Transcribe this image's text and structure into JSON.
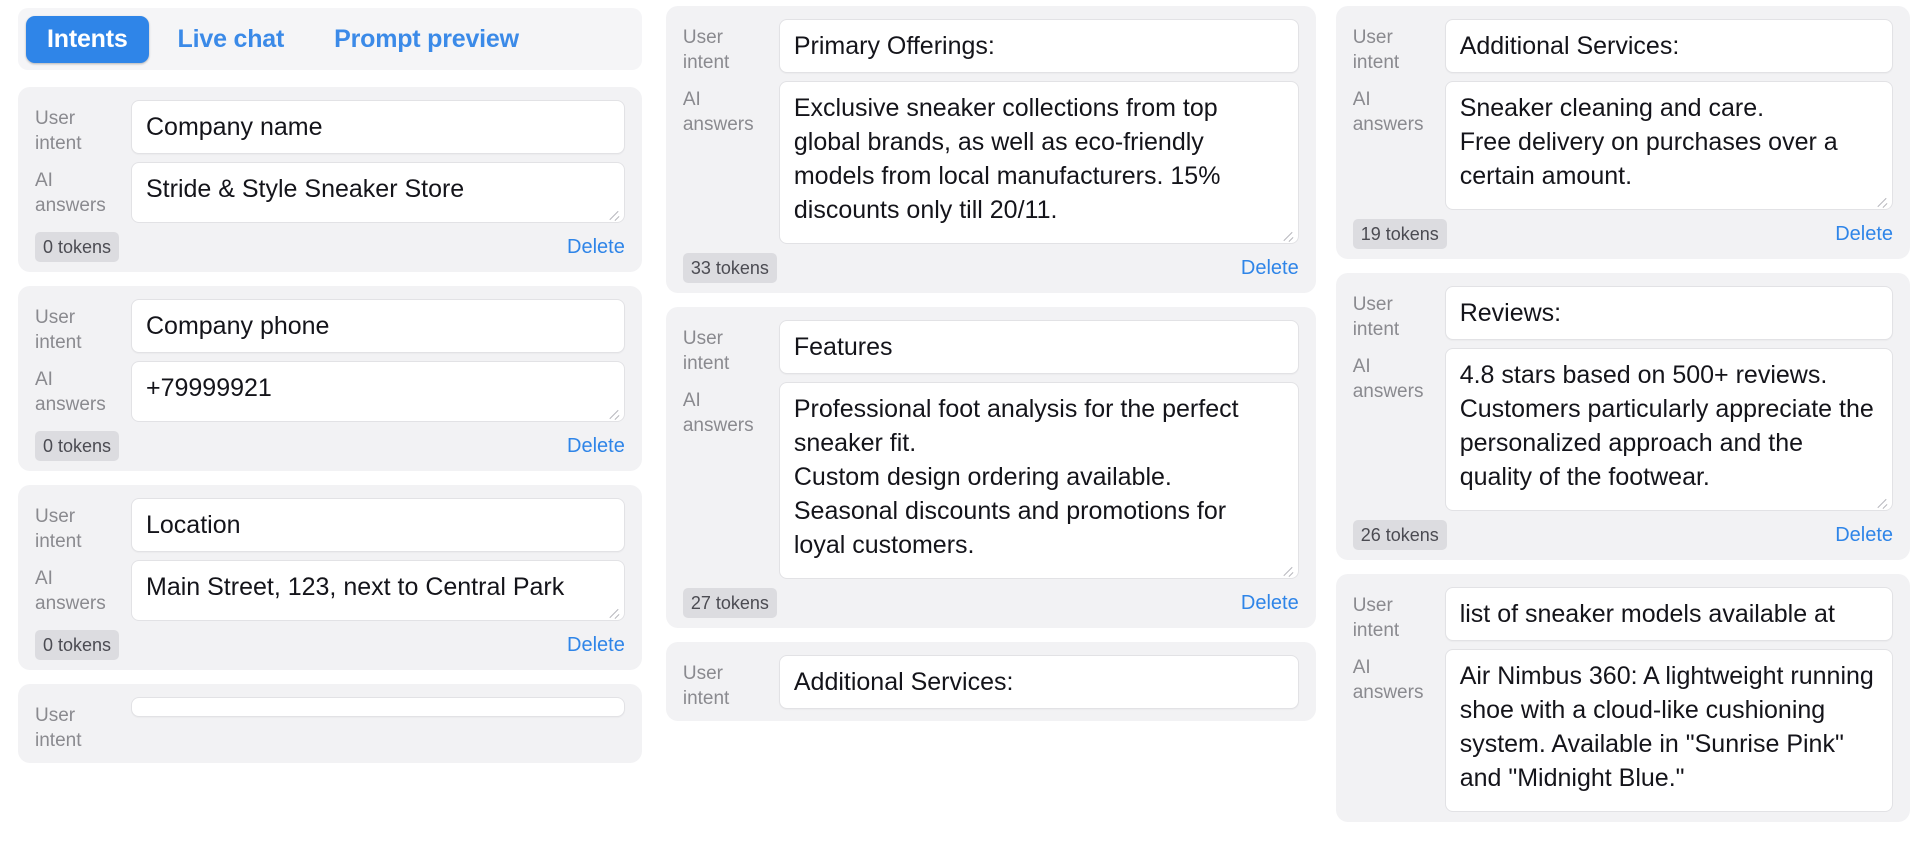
{
  "tabs": [
    {
      "label": "Intents",
      "active": true
    },
    {
      "label": "Live chat",
      "active": false
    },
    {
      "label": "Prompt preview",
      "active": false
    }
  ],
  "labels": {
    "user_intent": "User\nintent",
    "ai_answers": "AI\nanswers",
    "delete": "Delete"
  },
  "colors": {
    "accent": "#2f85e8",
    "link": "#2f85e8",
    "card_bg": "#f2f2f4",
    "field_bg": "#ffffff",
    "label_text": "#8a8a8f",
    "token_badge_bg": "#dcdce0"
  },
  "columns": [
    {
      "id": "column-1",
      "has_tabbar": true,
      "cards": [
        {
          "intent": "Company name",
          "answer": "Stride & Style Sneaker Store",
          "tokens": "0 tokens",
          "delete": "Delete",
          "answer_lines": 1
        },
        {
          "intent": "Company phone",
          "answer": "+79999921",
          "tokens": "0 tokens",
          "delete": "Delete",
          "answer_lines": 1
        },
        {
          "intent": "Location",
          "answer": "Main Street, 123, next to Central Park",
          "tokens": "0 tokens",
          "delete": "Delete",
          "answer_lines": 2
        },
        {
          "intent": "",
          "answer": "",
          "tokens": "",
          "delete": "",
          "clipped": true
        }
      ]
    },
    {
      "id": "column-2",
      "has_tabbar": false,
      "cards": [
        {
          "intent": "Primary Offerings:",
          "answer": "Exclusive sneaker collections from top global brands, as well as eco-friendly models from local manufacturers. 15% discounts only till 20/11.",
          "tokens": "33 tokens",
          "delete": "Delete",
          "answer_lines": 5
        },
        {
          "intent": "Features",
          "answer": "Professional foot analysis for the perfect sneaker fit.\nCustom design ordering available.\nSeasonal discounts and promotions for loyal customers.",
          "tokens": "27 tokens",
          "delete": "Delete",
          "answer_lines": 6
        },
        {
          "intent": "Additional Services:",
          "answer": "",
          "tokens": "",
          "delete": "",
          "clipped": true
        }
      ]
    },
    {
      "id": "column-3",
      "has_tabbar": false,
      "cards": [
        {
          "intent": "Additional Services:",
          "answer": "Sneaker cleaning and care.\nFree delivery on purchases over a certain amount.",
          "tokens": "19 tokens",
          "delete": "Delete",
          "answer_lines": 3
        },
        {
          "intent": "Reviews:",
          "answer": "4.8 stars based on 500+ reviews. Customers particularly appreciate the personalized approach and the quality of the footwear.",
          "tokens": "26 tokens",
          "delete": "Delete",
          "answer_lines": 5
        },
        {
          "intent": "list of sneaker models available at",
          "answer": "Air Nimbus 360: A lightweight running shoe with a cloud-like cushioning system. Available in \"Sunrise Pink\" and \"Midnight Blue.\"",
          "tokens": "",
          "delete": "",
          "clipped": true,
          "answer_lines": 5
        }
      ]
    }
  ]
}
